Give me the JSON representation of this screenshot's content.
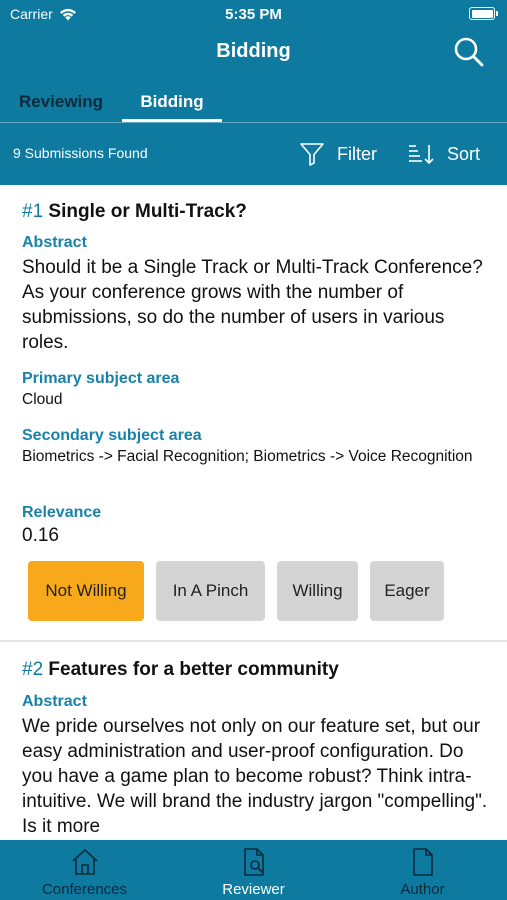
{
  "status_bar": {
    "carrier": "Carrier",
    "time": "5:35 PM"
  },
  "nav": {
    "title": "Bidding"
  },
  "tabs": [
    {
      "label": "Reviewing"
    },
    {
      "label": "Bidding",
      "selected": true
    }
  ],
  "filterbar": {
    "found": "9 Submissions Found",
    "filter_label": "Filter",
    "sort_label": "Sort"
  },
  "submissions": [
    {
      "num": "#1",
      "title": "Single or Multi-Track?",
      "abstract_label": "Abstract",
      "abstract": "Should it be a Single Track or Multi-Track Conference?  As your conference grows with the number of submissions, so do the number of users in various roles.",
      "primary_label": "Primary subject area",
      "primary": "Cloud",
      "secondary_label": "Secondary subject area",
      "secondary": "Biometrics -> Facial Recognition; Biometrics -> Voice Recognition",
      "relevance_label": "Relevance",
      "relevance": "0.16",
      "bids": [
        "Not Willing",
        "In A Pinch",
        "Willing",
        "Eager"
      ],
      "selected_bid": "Not Willing"
    },
    {
      "num": "#2",
      "title": "Features for a better community",
      "abstract_label": "Abstract",
      "abstract": "We pride ourselves not only on our feature set, but our easy administration and user-proof configuration. Do you have a game plan to become robust? Think intra-intuitive. We will brand the industry jargon \"compelling\". Is it more"
    }
  ],
  "bottom_tabs": [
    {
      "label": "Conferences",
      "icon": "house-icon"
    },
    {
      "label": "Reviewer",
      "icon": "document-search-icon",
      "selected": true
    },
    {
      "label": "Author",
      "icon": "document-icon"
    }
  ],
  "colors": {
    "primary": "#0e7aa0",
    "accent": "#f7a81b",
    "label": "#1a82a8",
    "inactive_button": "#d4d4d4"
  }
}
